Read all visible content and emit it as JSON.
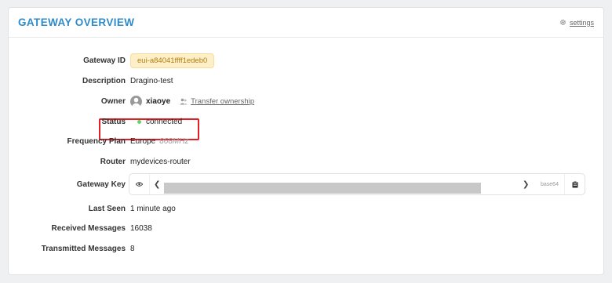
{
  "header": {
    "title": "GATEWAY OVERVIEW",
    "settings_label": "settings"
  },
  "fields": {
    "gateway_id": {
      "label": "Gateway ID",
      "value": "eui-a84041ffff1edeb0"
    },
    "description": {
      "label": "Description",
      "value": "Dragino-test"
    },
    "owner": {
      "label": "Owner",
      "name": "xiaoye",
      "transfer_label": "Transfer ownership"
    },
    "status": {
      "label": "Status",
      "value": "connected",
      "color": "#5cd66a",
      "highlight_color": "#e31e24"
    },
    "frequency_plan": {
      "label": "Frequency Plan",
      "region": "Europe",
      "band": "868MHz"
    },
    "router": {
      "label": "Router",
      "value": "mydevices-router"
    },
    "gateway_key": {
      "label": "Gateway Key",
      "encoding": "base64"
    },
    "last_seen": {
      "label": "Last Seen",
      "value": "1 minute ago"
    },
    "received_messages": {
      "label": "Received Messages",
      "value": "16038"
    },
    "transmitted_messages": {
      "label": "Transmitted Messages",
      "value": "8"
    }
  },
  "colors": {
    "accent": "#2e8bc9",
    "badge_bg": "#fdefc8",
    "badge_text": "#b07d12"
  },
  "icons": {
    "settings": "gear-icon",
    "owner": "user-avatar-icon",
    "transfer": "users-icon",
    "reveal": "eye-icon",
    "copy": "clipboard-icon",
    "scroll_left": "chevron-left-icon",
    "scroll_right": "chevron-right-icon"
  }
}
